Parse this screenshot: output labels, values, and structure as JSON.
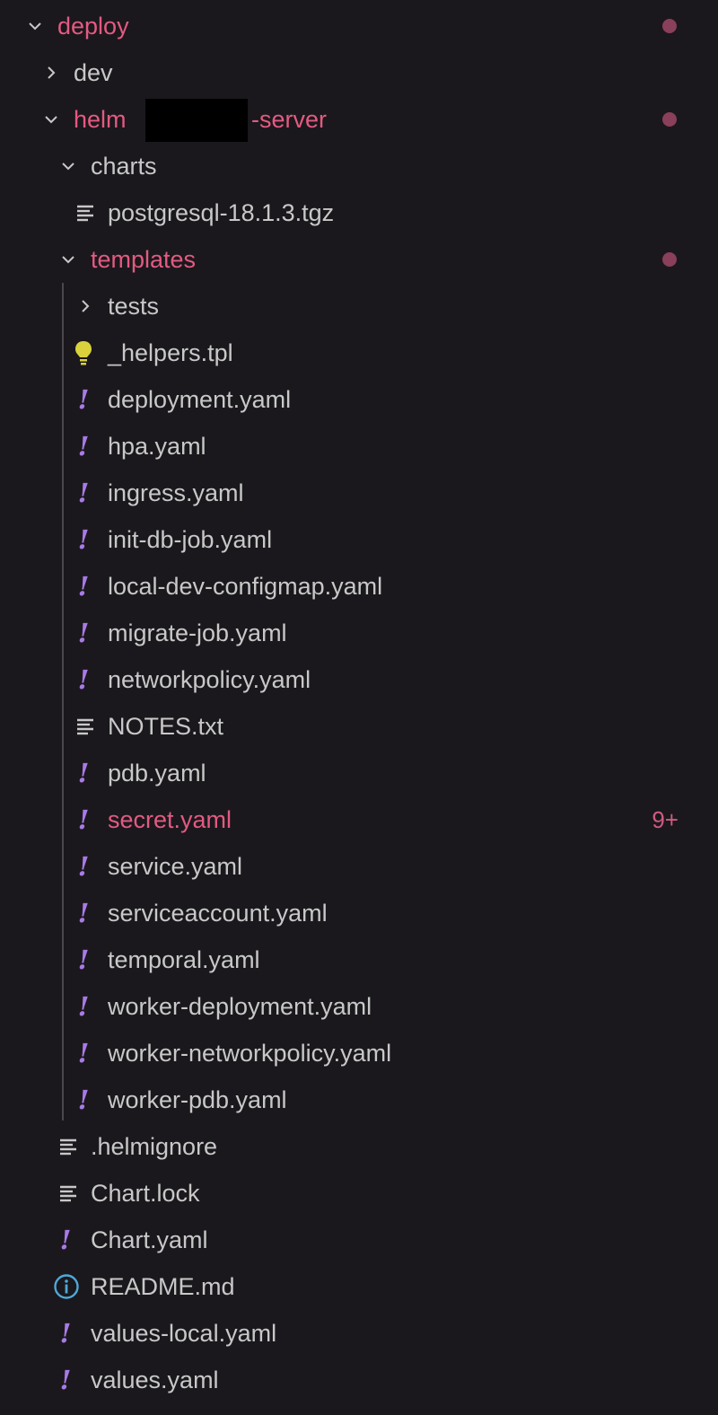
{
  "colors": {
    "modified": "#e35a82",
    "yaml_icon": "#a87ae6",
    "bulb_icon": "#d9d23c",
    "info_icon": "#4fa8d8"
  },
  "tree": {
    "deploy": {
      "label": "deploy",
      "icon": "chevron-down"
    },
    "dev": {
      "label": "dev",
      "icon": "chevron-right"
    },
    "helm": {
      "label_prefix": "helm",
      "label_suffix": "-server",
      "icon": "chevron-down"
    },
    "charts": {
      "label": "charts",
      "icon": "chevron-down"
    },
    "postgresql": {
      "label": "postgresql-18.1.3.tgz",
      "icon": "text-file"
    },
    "templates": {
      "label": "templates",
      "icon": "chevron-down"
    },
    "tests": {
      "label": "tests",
      "icon": "chevron-right"
    },
    "templates_files": [
      {
        "label": "_helpers.tpl",
        "icon": "lightbulb"
      },
      {
        "label": "deployment.yaml",
        "icon": "yaml-exclamation"
      },
      {
        "label": "hpa.yaml",
        "icon": "yaml-exclamation"
      },
      {
        "label": "ingress.yaml",
        "icon": "yaml-exclamation"
      },
      {
        "label": "init-db-job.yaml",
        "icon": "yaml-exclamation"
      },
      {
        "label": "local-dev-configmap.yaml",
        "icon": "yaml-exclamation"
      },
      {
        "label": "migrate-job.yaml",
        "icon": "yaml-exclamation"
      },
      {
        "label": "networkpolicy.yaml",
        "icon": "yaml-exclamation"
      },
      {
        "label": "NOTES.txt",
        "icon": "text-file"
      },
      {
        "label": "pdb.yaml",
        "icon": "yaml-exclamation"
      },
      {
        "label": "secret.yaml",
        "icon": "yaml-exclamation",
        "badge": "9+"
      },
      {
        "label": "service.yaml",
        "icon": "yaml-exclamation"
      },
      {
        "label": "serviceaccount.yaml",
        "icon": "yaml-exclamation"
      },
      {
        "label": "temporal.yaml",
        "icon": "yaml-exclamation"
      },
      {
        "label": "worker-deployment.yaml",
        "icon": "yaml-exclamation"
      },
      {
        "label": "worker-networkpolicy.yaml",
        "icon": "yaml-exclamation"
      },
      {
        "label": "worker-pdb.yaml",
        "icon": "yaml-exclamation"
      }
    ],
    "helm_files": [
      {
        "label": ".helmignore",
        "icon": "text-file"
      },
      {
        "label": "Chart.lock",
        "icon": "text-file"
      },
      {
        "label": "Chart.yaml",
        "icon": "yaml-exclamation"
      },
      {
        "label": "README.md",
        "icon": "info"
      },
      {
        "label": "values-local.yaml",
        "icon": "yaml-exclamation"
      },
      {
        "label": "values.yaml",
        "icon": "yaml-exclamation"
      }
    ]
  }
}
